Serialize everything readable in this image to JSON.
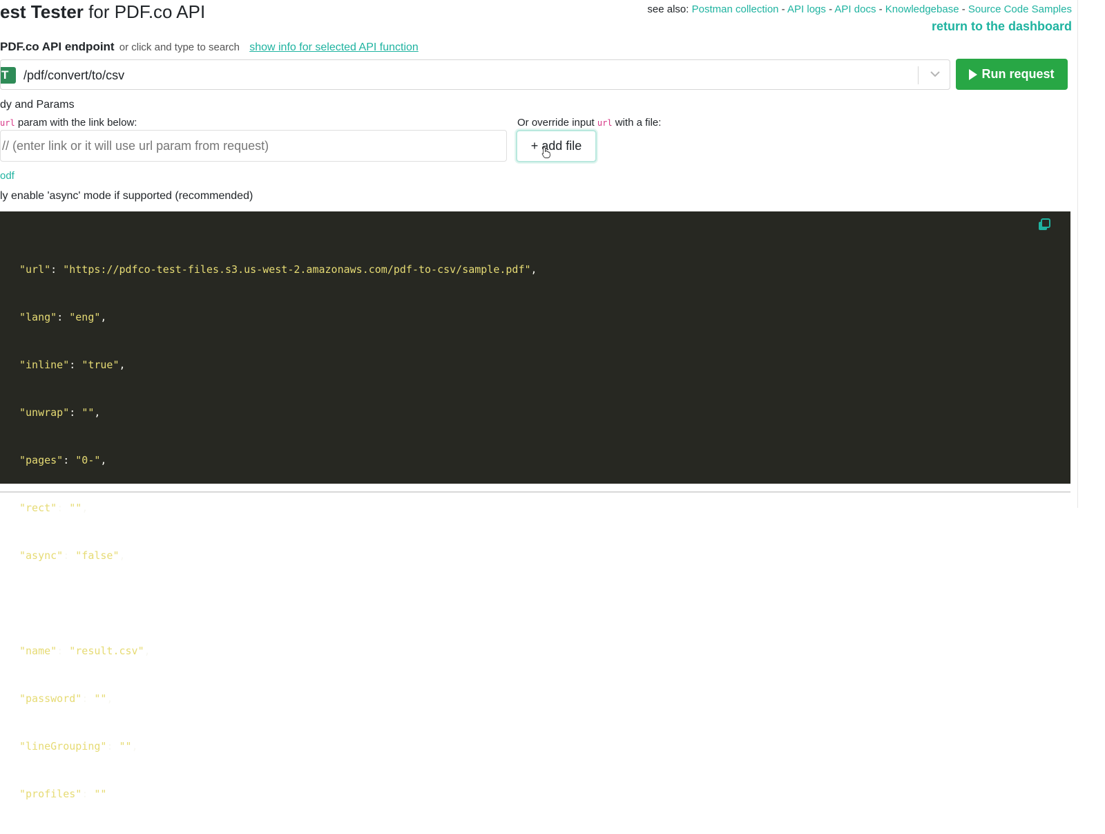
{
  "header": {
    "title_bold": "est Tester",
    "title_rest": " for PDF.co API",
    "see_also_label": "see also:",
    "links": [
      "Postman collection",
      "API logs",
      "API docs",
      "Knowledgebase",
      "Source Code Samples"
    ],
    "link_separator": " - ",
    "dashboard": "return to the dashboard"
  },
  "endpoint": {
    "label_bold": "PDF.co API endpoint",
    "label_hint": "or click and type to search",
    "info_link": "show info for selected API function",
    "method_badge": "T",
    "path": "/pdf/convert/to/csv"
  },
  "run_button": "Run request",
  "params": {
    "section_label": "dy and Params",
    "url_code": "url",
    "url_hint_suffix": "param with the link below:",
    "override_prefix": "Or override input",
    "override_code": "url",
    "override_suffix": "with a file:",
    "url_placeholder": "// (enter link or it will use url param from request)",
    "add_file": "+ add file",
    "sample_link": "odf",
    "async_label": "ly enable 'async' mode if supported (recommended)"
  },
  "code": {
    "lines": [
      {
        "key": "\"url\"",
        "value": "\"https://pdfco-test-files.s3.us-west-2.amazonaws.com/pdf-to-csv/sample.pdf\"",
        "tail": ","
      },
      {
        "key": "\"lang\"",
        "value": "\"eng\"",
        "tail": ","
      },
      {
        "key": "\"inline\"",
        "value": "\"true\"",
        "tail": ","
      },
      {
        "key": "\"unwrap\"",
        "value": "\"\"",
        "tail": ","
      },
      {
        "key": "\"pages\"",
        "value": "\"0-\"",
        "tail": ","
      },
      {
        "key": "\"rect\"",
        "value": "\"\"",
        "tail": ","
      },
      {
        "key": "\"async\"",
        "value": "\"false\"",
        "tail": ","
      },
      {
        "key": "",
        "value": "",
        "tail": ""
      },
      {
        "key": "\"name\"",
        "value": "\"result.csv\"",
        "tail": ","
      },
      {
        "key": "\"password\"",
        "value": "\"\"",
        "tail": ","
      },
      {
        "key": "\"lineGrouping\"",
        "value": "\"\"",
        "tail": ","
      },
      {
        "key": "\"profiles\"",
        "value": "\"\"",
        "tail": ""
      }
    ]
  },
  "colors": {
    "accent": "#1fb3a0",
    "run_button": "#28a745",
    "method_badge": "#2e8b57",
    "code_bg": "#272822",
    "code_string": "#e6db74"
  },
  "icons": {
    "run": "play-icon",
    "select": "chevron-down-icon",
    "copy": "copy-icon",
    "pointer": "hand-cursor-icon"
  }
}
